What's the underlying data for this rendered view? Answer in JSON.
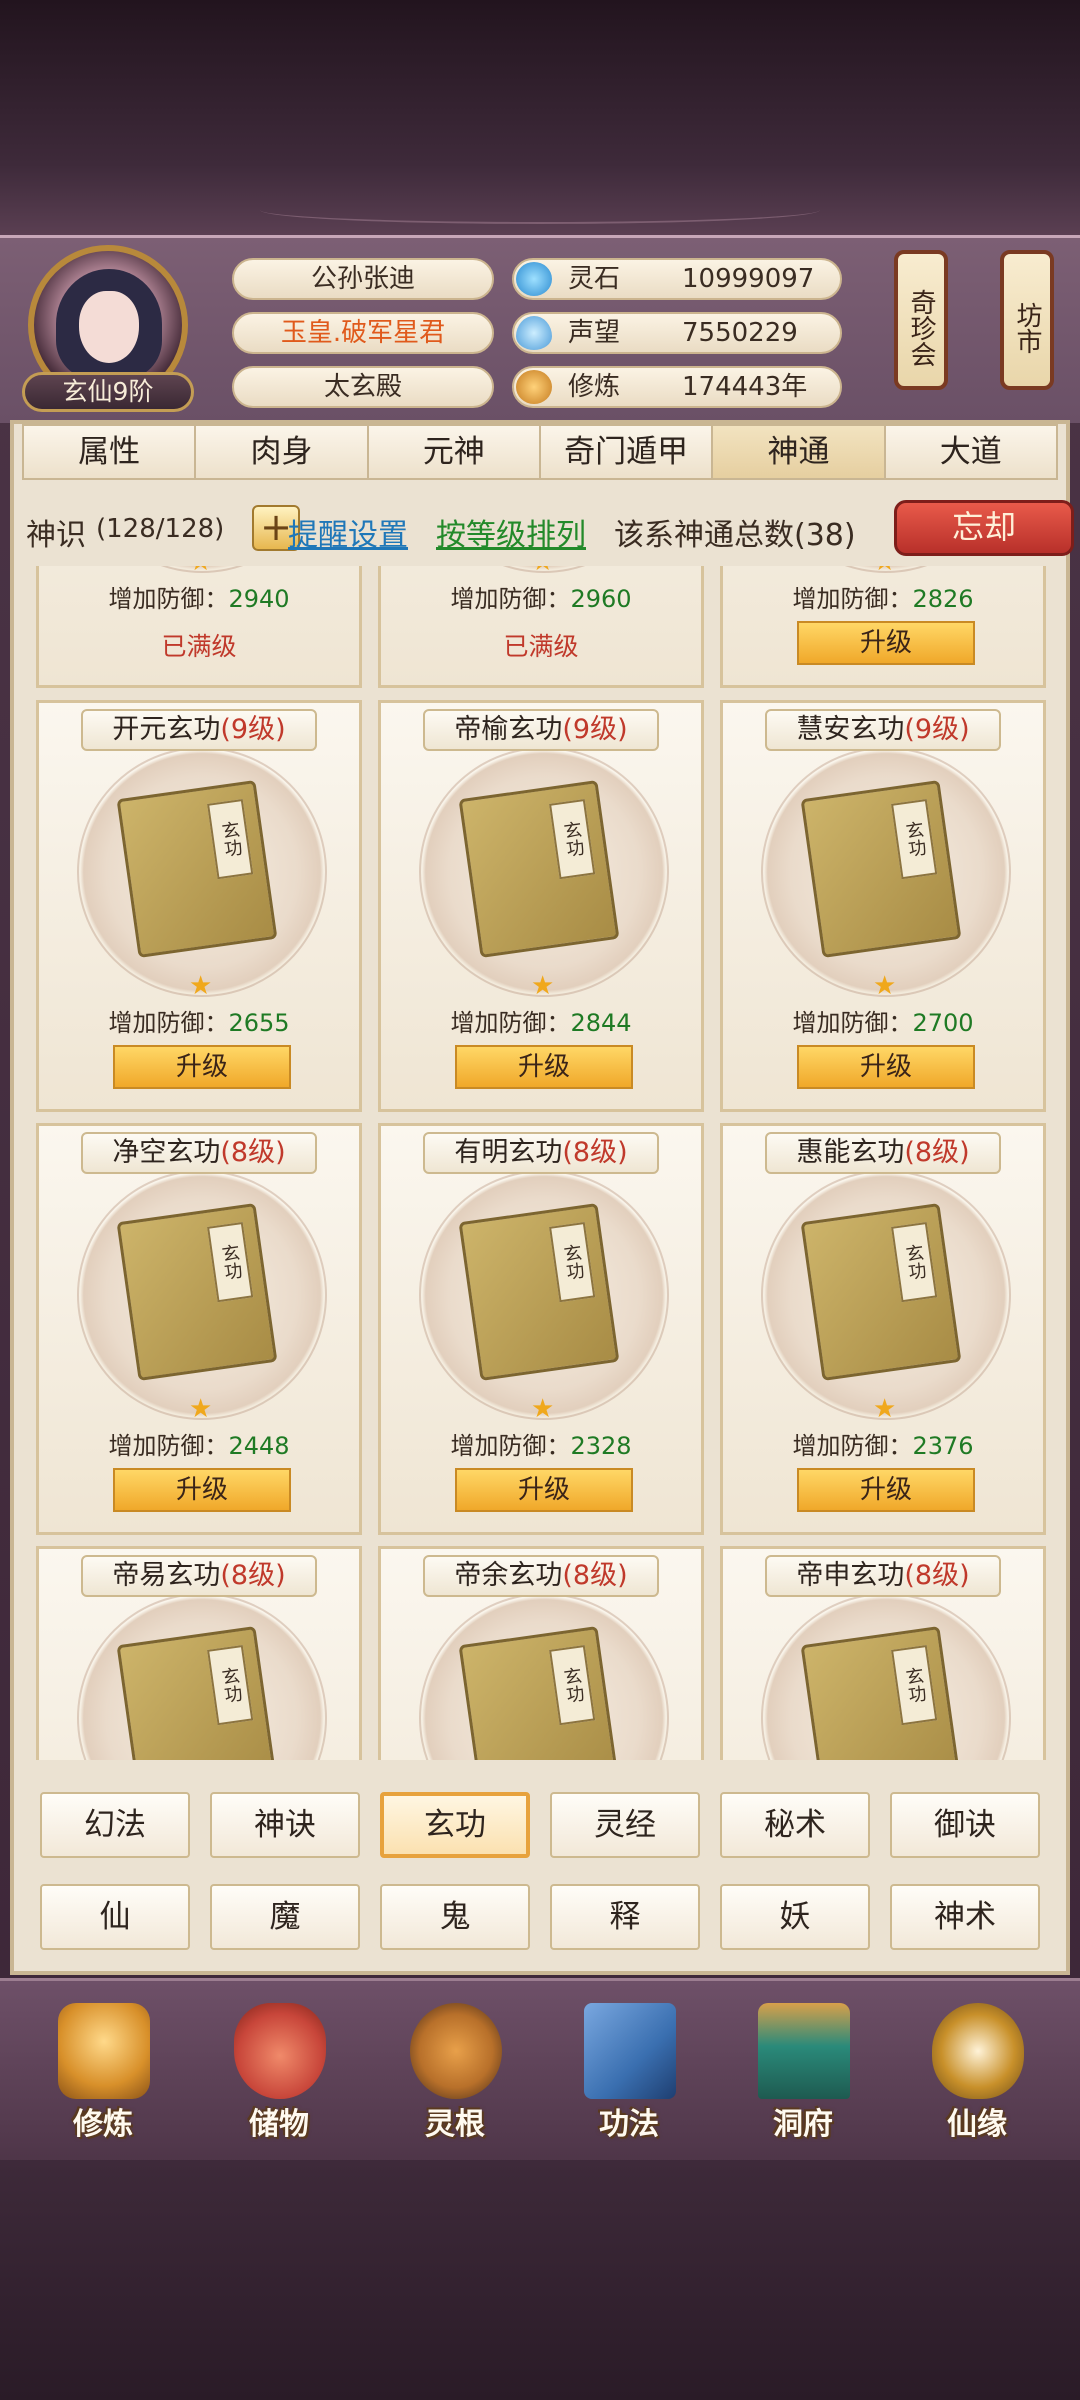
{
  "player": {
    "name": "公孙张迪",
    "title": "玉皇.破军星君",
    "location": "太玄殿",
    "rank": "玄仙9阶"
  },
  "resources": [
    {
      "name": "灵石",
      "value": "10999097",
      "icon": "spirit-stone-icon",
      "color": "#3aa0d8"
    },
    {
      "name": "声望",
      "value": "7550229",
      "icon": "reputation-icon",
      "color": "#4fa7e0"
    },
    {
      "name": "修炼",
      "value": "174443年",
      "icon": "meditation-icon",
      "color": "#d99a3a"
    }
  ],
  "side_buttons": {
    "treasure": "奇珍会",
    "market": "坊市"
  },
  "tabs": [
    "属性",
    "肉身",
    "元神",
    "奇门遁甲",
    "神通",
    "大道"
  ],
  "active_tab": "神通",
  "toolbar": {
    "sense_label": "神识",
    "sense_value": "(128/128)",
    "plus": "+",
    "remind": "提醒设置",
    "sort": "按等级排列",
    "total": "该系神通总数(38)",
    "forget": "忘却"
  },
  "cards": [
    {
      "name": "",
      "level": "",
      "stat_label": "增加防御：",
      "stat_value": "2940",
      "status": "已满级"
    },
    {
      "name": "",
      "level": "",
      "stat_label": "增加防御：",
      "stat_value": "2960",
      "status": "已满级"
    },
    {
      "name": "",
      "level": "",
      "stat_label": "增加防御：",
      "stat_value": "2826",
      "status": "升级"
    },
    {
      "name": "开元玄功",
      "level": "(9级)",
      "stat_label": "增加防御：",
      "stat_value": "2655",
      "status": "升级"
    },
    {
      "name": "帝榆玄功",
      "level": "(9级)",
      "stat_label": "增加防御：",
      "stat_value": "2844",
      "status": "升级"
    },
    {
      "name": "慧安玄功",
      "level": "(9级)",
      "stat_label": "增加防御：",
      "stat_value": "2700",
      "status": "升级"
    },
    {
      "name": "净空玄功",
      "level": "(8级)",
      "stat_label": "增加防御：",
      "stat_value": "2448",
      "status": "升级"
    },
    {
      "name": "有明玄功",
      "level": "(8级)",
      "stat_label": "增加防御：",
      "stat_value": "2328",
      "status": "升级"
    },
    {
      "name": "惠能玄功",
      "level": "(8级)",
      "stat_label": "增加防御：",
      "stat_value": "2376",
      "status": "升级"
    },
    {
      "name": "帝易玄功",
      "level": "(8级)",
      "stat_label": "",
      "stat_value": "",
      "status": ""
    },
    {
      "name": "帝余玄功",
      "level": "(8级)",
      "stat_label": "",
      "stat_value": "",
      "status": ""
    },
    {
      "name": "帝申玄功",
      "level": "(8级)",
      "stat_label": "",
      "stat_value": "",
      "status": ""
    }
  ],
  "book_label": "玄功",
  "categories_row1": [
    "幻法",
    "神诀",
    "玄功",
    "灵经",
    "秘术",
    "御诀"
  ],
  "categories_row2": [
    "仙",
    "魔",
    "鬼",
    "释",
    "妖",
    "神术"
  ],
  "active_category": "玄功",
  "nav": [
    {
      "label": "修炼",
      "icon": "cultivate-icon",
      "color": "#d8902a"
    },
    {
      "label": "储物",
      "icon": "storage-bag-icon",
      "color": "#c8463a"
    },
    {
      "label": "灵根",
      "icon": "spirit-root-icon",
      "color": "#b8702a"
    },
    {
      "label": "功法",
      "icon": "technique-book-icon",
      "color": "#3a6fb0"
    },
    {
      "label": "洞府",
      "icon": "cave-dwelling-icon",
      "color": "#2a8a7a"
    },
    {
      "label": "仙缘",
      "icon": "immortal-fate-icon",
      "color": "#c8902a"
    }
  ]
}
